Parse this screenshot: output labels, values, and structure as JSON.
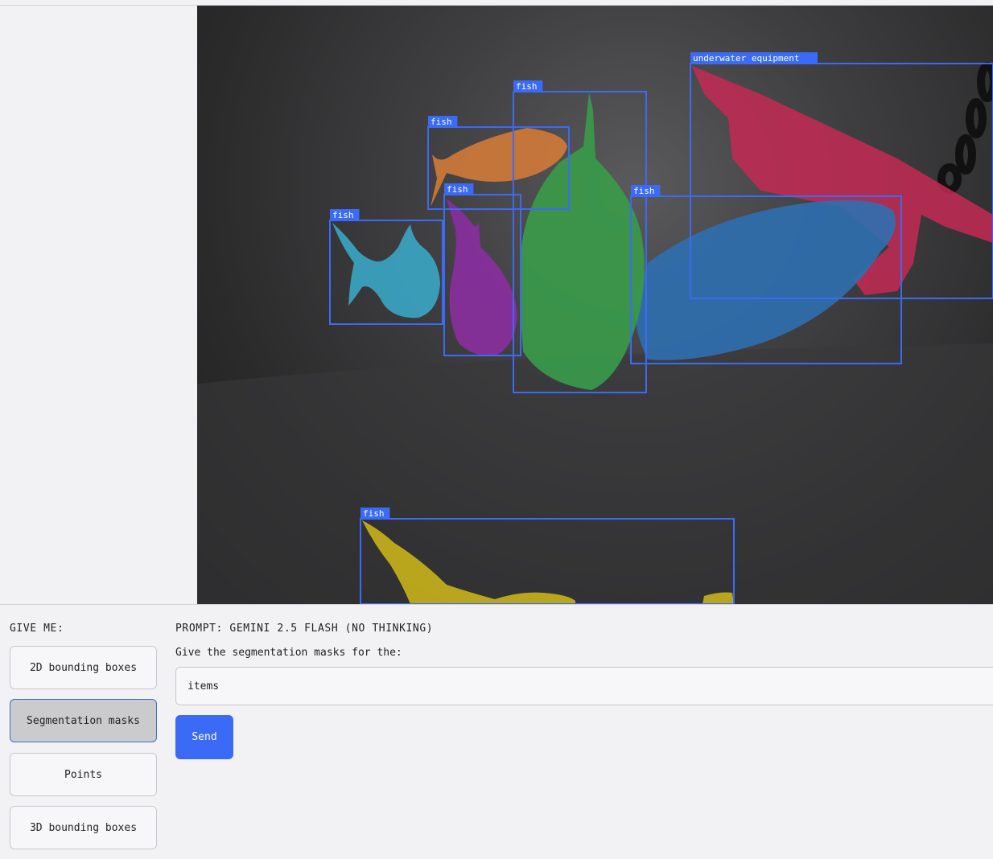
{
  "viewer": {
    "detections": [
      {
        "label": "fish",
        "mask_color": "#d07a38"
      },
      {
        "label": "fish",
        "mask_color": "#3a9a4a"
      },
      {
        "label": "underwater equipment",
        "mask_color": "#c42a55"
      },
      {
        "label": "fish",
        "mask_color": "#3aa6c4"
      },
      {
        "label": "fish",
        "mask_color": "#8a2ea0"
      },
      {
        "label": "fish",
        "mask_color": "#2f6fb0"
      },
      {
        "label": "fish",
        "mask_color": "#c9b21a"
      }
    ],
    "box_color": "#3b6bf6"
  },
  "controls": {
    "give_me_label": "GIVE ME:",
    "modes": [
      {
        "label": "2D bounding boxes",
        "selected": false
      },
      {
        "label": "Segmentation masks",
        "selected": true
      },
      {
        "label": "Points",
        "selected": false
      },
      {
        "label": "3D bounding boxes",
        "selected": false
      }
    ]
  },
  "prompt": {
    "header": "PROMPT: GEMINI 2.5 FLASH (NO THINKING)",
    "caption": "Give the segmentation masks for the:",
    "input_value": "items",
    "send_label": "Send"
  }
}
